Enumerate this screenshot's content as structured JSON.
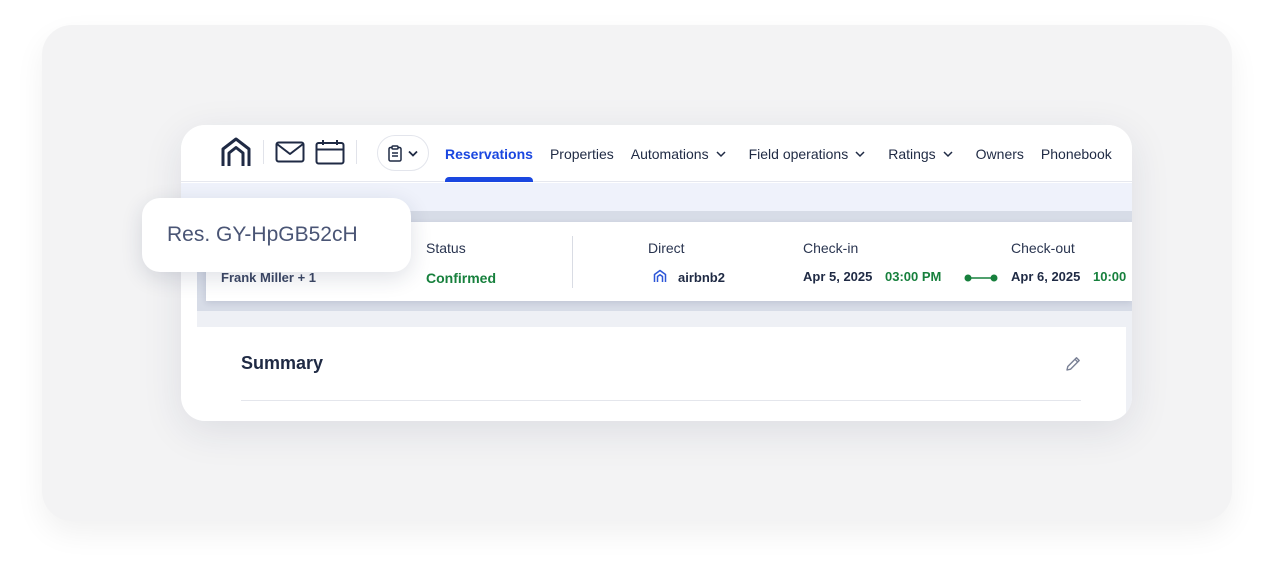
{
  "nav": {
    "items": [
      {
        "label": "Reservations",
        "active": true,
        "dropdown": false
      },
      {
        "label": "Properties",
        "active": false,
        "dropdown": false
      },
      {
        "label": "Automations",
        "active": false,
        "dropdown": true
      },
      {
        "label": "Field operations",
        "active": false,
        "dropdown": true
      },
      {
        "label": "Ratings",
        "active": false,
        "dropdown": true
      },
      {
        "label": "Owners",
        "active": false,
        "dropdown": false
      },
      {
        "label": "Phonebook",
        "active": false,
        "dropdown": false
      }
    ],
    "icons": [
      "home-icon",
      "mail-icon",
      "calendar-icon",
      "clipboard-icon"
    ]
  },
  "reservation": {
    "badge": "Res. GY-HpGB52cH",
    "guest": "Frank Miller + 1",
    "status_label": "Status",
    "status_value": "Confirmed",
    "channel_label": "Direct",
    "channel_value": "airbnb2",
    "checkin_label": "Check-in",
    "checkin_date": "Apr 5, 2025",
    "checkin_time": "03:00 PM",
    "checkout_label": "Check-out",
    "checkout_date": "Apr 6, 2025",
    "checkout_time": "10:00"
  },
  "summary": {
    "title": "Summary"
  },
  "colors": {
    "accent": "#1a47e0",
    "success": "#17803d",
    "text": "#1f2a44"
  }
}
